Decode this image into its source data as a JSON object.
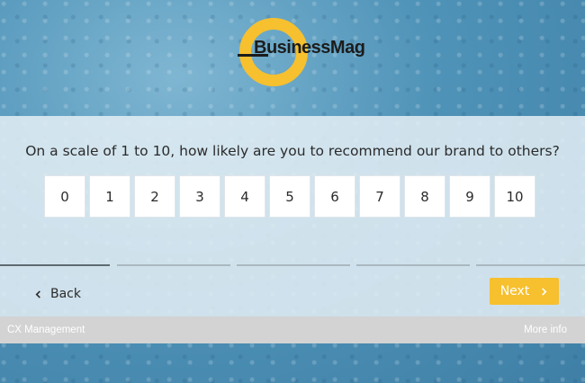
{
  "brand": {
    "name": "BusinessMag",
    "accent_color": "#f6c02e"
  },
  "survey": {
    "question": "On a scale of 1 to 10, how likely are you to recommend our brand to others?",
    "scale_options": [
      "0",
      "1",
      "2",
      "3",
      "4",
      "5",
      "6",
      "7",
      "8",
      "9",
      "10"
    ],
    "progress": {
      "total_steps": 5,
      "current_step": 1
    }
  },
  "navigation": {
    "back_label": "Back",
    "back_icon": "chevron-left-icon",
    "next_label": "Next",
    "next_icon": "chevron-right-icon"
  },
  "footer": {
    "left_label": "CX Management",
    "right_label": "More info"
  }
}
